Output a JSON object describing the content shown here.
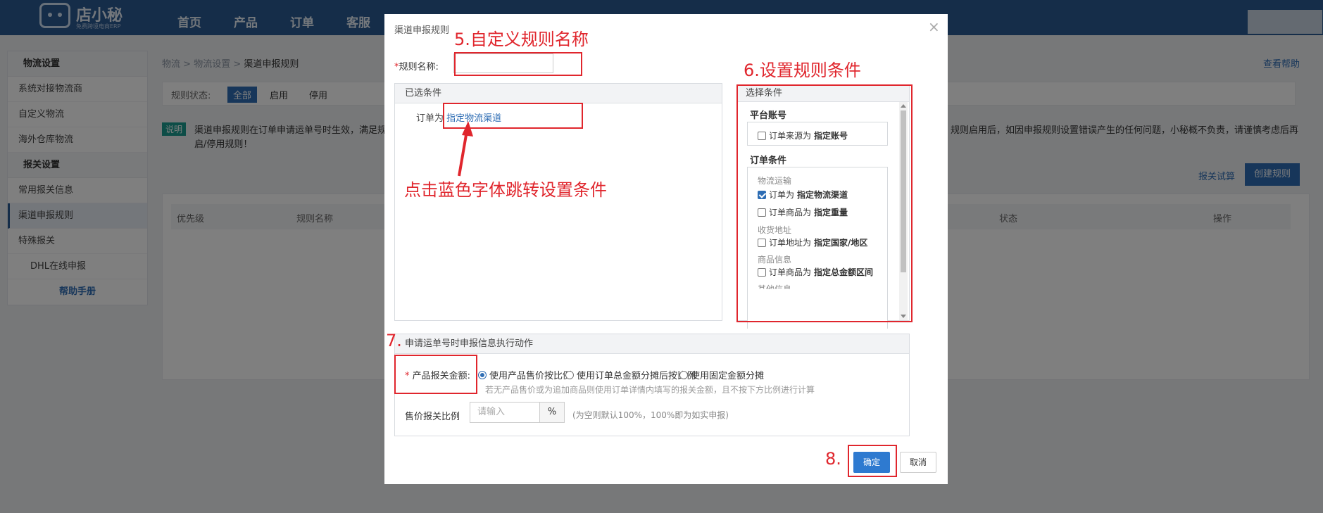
{
  "topbar": {
    "logo_name": "店小秘",
    "logo_sub": "免费跨境电商ERP",
    "nav": [
      "首页",
      "产品",
      "订单",
      "客服"
    ]
  },
  "sidebar": {
    "sections": [
      {
        "title": "物流设置",
        "items": [
          "系统对接物流商",
          "自定义物流",
          "海外仓库物流"
        ]
      },
      {
        "title": "报关设置",
        "items": [
          "常用报关信息",
          "渠道申报规则",
          "特殊报关",
          "DHL在线申报"
        ]
      }
    ],
    "help": "帮助手册"
  },
  "main": {
    "breadcrumb": [
      "物流",
      "物流设置",
      "渠道申报规则"
    ],
    "help_link": "查看帮助",
    "status_label": "规则状态:",
    "status_options": [
      "全部",
      "启用",
      "停用"
    ],
    "notice_tag": "说明",
    "notice_text_1": "渠道申报规则在订单申请运单号时生效，满足规",
    "notice_text_2": "规则启用后，如因申报规则设置错误产生的任何问题，小秘概不负责，请谨慎考虑后再",
    "notice_text_3": "启/停用规则！",
    "trial_link": "报关试算",
    "create_button": "创建规则",
    "table_headers": [
      "优先级",
      "规则名称",
      "状态",
      "操作"
    ]
  },
  "modal": {
    "title": "渠道申报规则",
    "rule_name_label": "规则名称:",
    "rule_name_value": "",
    "selected_conditions_header": "已选条件",
    "condition_prefix": "订单为",
    "condition_link": "指定物流渠道",
    "choose_header": "选择条件",
    "platform_section": "平台账号",
    "platform_option": {
      "prefix": "订单来源为",
      "bold": "指定账号",
      "checked": false
    },
    "order_section": "订单条件",
    "groups": [
      {
        "label": "物流运输",
        "options": [
          {
            "prefix": "订单为",
            "bold": "指定物流渠道",
            "checked": true
          },
          {
            "prefix": "订单商品为",
            "bold": "指定重量",
            "checked": false
          }
        ]
      },
      {
        "label": "收货地址",
        "options": [
          {
            "prefix": "订单地址为",
            "bold": "指定国家/地区",
            "checked": false
          }
        ]
      },
      {
        "label": "商品信息",
        "options": [
          {
            "prefix": "订单商品为",
            "bold": "指定总金额区间",
            "checked": false
          }
        ]
      },
      {
        "label": "其他信息",
        "options": []
      }
    ],
    "action_header": "申请运单号时申报信息执行动作",
    "amount_label": "产品报关金额:",
    "amount_options": [
      "使用产品售价按比例",
      "使用订单总金额分摊后按比例",
      "使用固定金额分摊"
    ],
    "amount_selected": 0,
    "amount_hint": "若无产品售价或为追加商品则使用订单详情内填写的报关金额，且不按下方比例进行计算",
    "ratio_label": "售价报关比例",
    "ratio_placeholder": "请输入",
    "ratio_unit": "%",
    "ratio_note": "(为空则默认100%，100%即为如实申报)",
    "ok_button": "确定",
    "cancel_button": "取消",
    "close_icon": "×"
  },
  "annotations": {
    "step5": "5.自定义规则名称",
    "step6": "6.设置规则条件",
    "step7": "7.",
    "step8": "8.",
    "click_hint": "点击蓝色字体跳转设置条件"
  },
  "colors": {
    "accent": "#2e6db4",
    "annotation": "#e0262d",
    "topbar": "#2a5a92"
  }
}
